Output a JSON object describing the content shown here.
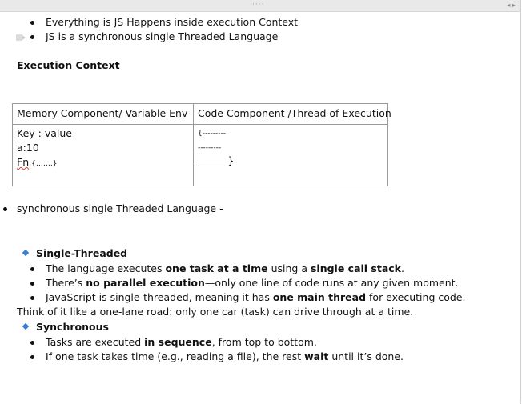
{
  "toolbar": {
    "grip": "····",
    "arrows": "◂ ▸"
  },
  "intro_bullets": [
    "Everything is JS Happens inside execution Context",
    "JS is  a synchronous single Threaded Language"
  ],
  "heading": "Execution Context",
  "table": {
    "headers": [
      "Memory Component/ Variable Env",
      "Code Component /Thread of Execution"
    ],
    "memory_lines": [
      "Key : value",
      "a:10"
    ],
    "memory_fn_prefix": "Fn",
    "memory_fn_rest": ":{…….}",
    "code_lines": [
      "{---------",
      "---------",
      "______}"
    ]
  },
  "section_bullet": "synchronous single Threaded Language -",
  "single_threaded": {
    "title": "Single-Threaded",
    "items": [
      {
        "pre": "The language executes ",
        "bold1": "one task at a time",
        "mid": " using a ",
        "bold2": "single call stack",
        "post": "."
      },
      {
        "pre": "There’s ",
        "bold1": "no parallel execution",
        "mid": "—only one line of code runs at any given moment.",
        "bold2": "",
        "post": ""
      },
      {
        "pre": "JavaScript is single-threaded, meaning it has ",
        "bold1": "one main thread",
        "mid": " for executing code.",
        "bold2": "",
        "post": ""
      }
    ]
  },
  "analogy": "Think of it like a one-lane road: only one car (task) can drive through at a time.",
  "synchronous": {
    "title": "Synchronous",
    "items": [
      {
        "pre": "Tasks are executed ",
        "bold1": "in sequence",
        "mid": ", from top to bottom.",
        "bold2": "",
        "post": ""
      },
      {
        "pre": "If one task takes time (e.g., reading a file), the rest ",
        "bold1": "wait",
        "mid": " until it’s done.",
        "bold2": "",
        "post": ""
      }
    ]
  },
  "colors": {
    "accent_diamond": "#3a7dd6",
    "spellcheck": "#d23c3c"
  }
}
